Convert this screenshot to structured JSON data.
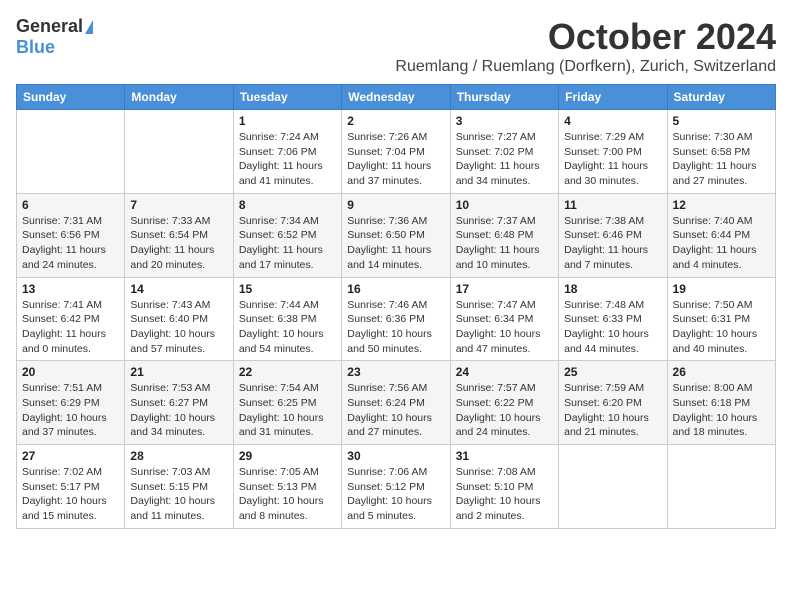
{
  "header": {
    "logo_general": "General",
    "logo_blue": "Blue",
    "month": "October 2024",
    "location": "Ruemlang / Ruemlang (Dorfkern), Zurich, Switzerland"
  },
  "weekdays": [
    "Sunday",
    "Monday",
    "Tuesday",
    "Wednesday",
    "Thursday",
    "Friday",
    "Saturday"
  ],
  "weeks": [
    [
      {
        "day": "",
        "sunrise": "",
        "sunset": "",
        "daylight": ""
      },
      {
        "day": "",
        "sunrise": "",
        "sunset": "",
        "daylight": ""
      },
      {
        "day": "1",
        "sunrise": "Sunrise: 7:24 AM",
        "sunset": "Sunset: 7:06 PM",
        "daylight": "Daylight: 11 hours and 41 minutes."
      },
      {
        "day": "2",
        "sunrise": "Sunrise: 7:26 AM",
        "sunset": "Sunset: 7:04 PM",
        "daylight": "Daylight: 11 hours and 37 minutes."
      },
      {
        "day": "3",
        "sunrise": "Sunrise: 7:27 AM",
        "sunset": "Sunset: 7:02 PM",
        "daylight": "Daylight: 11 hours and 34 minutes."
      },
      {
        "day": "4",
        "sunrise": "Sunrise: 7:29 AM",
        "sunset": "Sunset: 7:00 PM",
        "daylight": "Daylight: 11 hours and 30 minutes."
      },
      {
        "day": "5",
        "sunrise": "Sunrise: 7:30 AM",
        "sunset": "Sunset: 6:58 PM",
        "daylight": "Daylight: 11 hours and 27 minutes."
      }
    ],
    [
      {
        "day": "6",
        "sunrise": "Sunrise: 7:31 AM",
        "sunset": "Sunset: 6:56 PM",
        "daylight": "Daylight: 11 hours and 24 minutes."
      },
      {
        "day": "7",
        "sunrise": "Sunrise: 7:33 AM",
        "sunset": "Sunset: 6:54 PM",
        "daylight": "Daylight: 11 hours and 20 minutes."
      },
      {
        "day": "8",
        "sunrise": "Sunrise: 7:34 AM",
        "sunset": "Sunset: 6:52 PM",
        "daylight": "Daylight: 11 hours and 17 minutes."
      },
      {
        "day": "9",
        "sunrise": "Sunrise: 7:36 AM",
        "sunset": "Sunset: 6:50 PM",
        "daylight": "Daylight: 11 hours and 14 minutes."
      },
      {
        "day": "10",
        "sunrise": "Sunrise: 7:37 AM",
        "sunset": "Sunset: 6:48 PM",
        "daylight": "Daylight: 11 hours and 10 minutes."
      },
      {
        "day": "11",
        "sunrise": "Sunrise: 7:38 AM",
        "sunset": "Sunset: 6:46 PM",
        "daylight": "Daylight: 11 hours and 7 minutes."
      },
      {
        "day": "12",
        "sunrise": "Sunrise: 7:40 AM",
        "sunset": "Sunset: 6:44 PM",
        "daylight": "Daylight: 11 hours and 4 minutes."
      }
    ],
    [
      {
        "day": "13",
        "sunrise": "Sunrise: 7:41 AM",
        "sunset": "Sunset: 6:42 PM",
        "daylight": "Daylight: 11 hours and 0 minutes."
      },
      {
        "day": "14",
        "sunrise": "Sunrise: 7:43 AM",
        "sunset": "Sunset: 6:40 PM",
        "daylight": "Daylight: 10 hours and 57 minutes."
      },
      {
        "day": "15",
        "sunrise": "Sunrise: 7:44 AM",
        "sunset": "Sunset: 6:38 PM",
        "daylight": "Daylight: 10 hours and 54 minutes."
      },
      {
        "day": "16",
        "sunrise": "Sunrise: 7:46 AM",
        "sunset": "Sunset: 6:36 PM",
        "daylight": "Daylight: 10 hours and 50 minutes."
      },
      {
        "day": "17",
        "sunrise": "Sunrise: 7:47 AM",
        "sunset": "Sunset: 6:34 PM",
        "daylight": "Daylight: 10 hours and 47 minutes."
      },
      {
        "day": "18",
        "sunrise": "Sunrise: 7:48 AM",
        "sunset": "Sunset: 6:33 PM",
        "daylight": "Daylight: 10 hours and 44 minutes."
      },
      {
        "day": "19",
        "sunrise": "Sunrise: 7:50 AM",
        "sunset": "Sunset: 6:31 PM",
        "daylight": "Daylight: 10 hours and 40 minutes."
      }
    ],
    [
      {
        "day": "20",
        "sunrise": "Sunrise: 7:51 AM",
        "sunset": "Sunset: 6:29 PM",
        "daylight": "Daylight: 10 hours and 37 minutes."
      },
      {
        "day": "21",
        "sunrise": "Sunrise: 7:53 AM",
        "sunset": "Sunset: 6:27 PM",
        "daylight": "Daylight: 10 hours and 34 minutes."
      },
      {
        "day": "22",
        "sunrise": "Sunrise: 7:54 AM",
        "sunset": "Sunset: 6:25 PM",
        "daylight": "Daylight: 10 hours and 31 minutes."
      },
      {
        "day": "23",
        "sunrise": "Sunrise: 7:56 AM",
        "sunset": "Sunset: 6:24 PM",
        "daylight": "Daylight: 10 hours and 27 minutes."
      },
      {
        "day": "24",
        "sunrise": "Sunrise: 7:57 AM",
        "sunset": "Sunset: 6:22 PM",
        "daylight": "Daylight: 10 hours and 24 minutes."
      },
      {
        "day": "25",
        "sunrise": "Sunrise: 7:59 AM",
        "sunset": "Sunset: 6:20 PM",
        "daylight": "Daylight: 10 hours and 21 minutes."
      },
      {
        "day": "26",
        "sunrise": "Sunrise: 8:00 AM",
        "sunset": "Sunset: 6:18 PM",
        "daylight": "Daylight: 10 hours and 18 minutes."
      }
    ],
    [
      {
        "day": "27",
        "sunrise": "Sunrise: 7:02 AM",
        "sunset": "Sunset: 5:17 PM",
        "daylight": "Daylight: 10 hours and 15 minutes."
      },
      {
        "day": "28",
        "sunrise": "Sunrise: 7:03 AM",
        "sunset": "Sunset: 5:15 PM",
        "daylight": "Daylight: 10 hours and 11 minutes."
      },
      {
        "day": "29",
        "sunrise": "Sunrise: 7:05 AM",
        "sunset": "Sunset: 5:13 PM",
        "daylight": "Daylight: 10 hours and 8 minutes."
      },
      {
        "day": "30",
        "sunrise": "Sunrise: 7:06 AM",
        "sunset": "Sunset: 5:12 PM",
        "daylight": "Daylight: 10 hours and 5 minutes."
      },
      {
        "day": "31",
        "sunrise": "Sunrise: 7:08 AM",
        "sunset": "Sunset: 5:10 PM",
        "daylight": "Daylight: 10 hours and 2 minutes."
      },
      {
        "day": "",
        "sunrise": "",
        "sunset": "",
        "daylight": ""
      },
      {
        "day": "",
        "sunrise": "",
        "sunset": "",
        "daylight": ""
      }
    ]
  ]
}
